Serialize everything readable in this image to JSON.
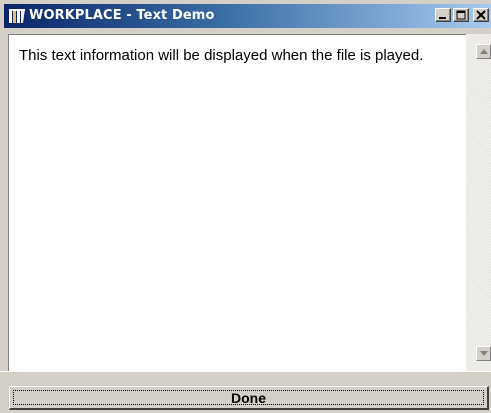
{
  "window": {
    "title": "WORKPLACE - Text Demo"
  },
  "content": {
    "text": "This text information will be displayed when the file is played."
  },
  "footer": {
    "done_label": "Done"
  },
  "icons": {
    "app": "workplace-app-icon",
    "minimize": "minimize-icon",
    "maximize": "maximize-icon",
    "close": "close-icon",
    "scroll_up": "scroll-up-arrow-icon",
    "scroll_down": "scroll-down-arrow-icon"
  },
  "colors": {
    "titlebar_start": "#0a246a",
    "titlebar_end": "#a6caf0",
    "chrome": "#d4d0c8"
  }
}
